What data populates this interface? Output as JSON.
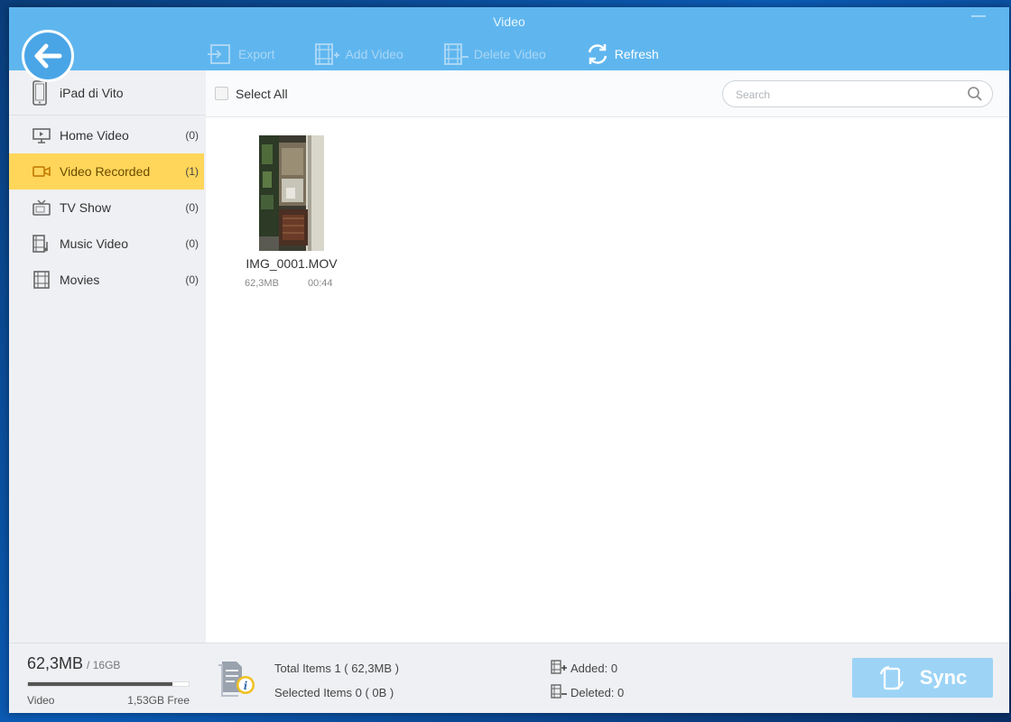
{
  "window": {
    "title": "Video",
    "minimize_glyph": "—"
  },
  "toolbar": {
    "export": "Export",
    "add_video": "Add Video",
    "delete_video": "Delete Video",
    "refresh": "Refresh"
  },
  "device": {
    "name": "iPad di Vito"
  },
  "sidebar": {
    "items": [
      {
        "label": "Home Video",
        "count": "(0)"
      },
      {
        "label": "Video Recorded",
        "count": "(1)"
      },
      {
        "label": "TV Show",
        "count": "(0)"
      },
      {
        "label": "Music Video",
        "count": "(0)"
      },
      {
        "label": "Movies",
        "count": "(0)"
      }
    ],
    "active_index": 1
  },
  "header": {
    "select_all": "Select All",
    "search_placeholder": "Search"
  },
  "files": [
    {
      "name": "IMG_0001.MOV",
      "size": "62,3MB",
      "duration": "00:44"
    }
  ],
  "storage": {
    "used": "62,3MB",
    "total": "/ 16GB",
    "category": "Video",
    "free": "1,53GB Free",
    "used_fraction": 0.9
  },
  "footer": {
    "total_items": "Total Items  1  ( 62,3MB )",
    "selected_items": "Selected Items  0  ( 0B )",
    "added": "Added:  0",
    "deleted": "Deleted:  0",
    "sync": "Sync"
  },
  "colors": {
    "title_bar": "#5fb6ef",
    "active_item": "#ffd65a",
    "sync_button": "#9dd4f6"
  }
}
